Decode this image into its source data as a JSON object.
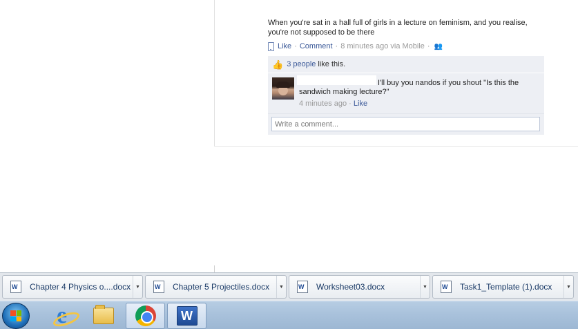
{
  "post": {
    "text": "When you're sat in a hall full of girls in a lecture on feminism, and you realise, you're not supposed to be there",
    "like_label": "Like",
    "comment_label": "Comment",
    "time": "8 minutes ago via Mobile",
    "sep": "·"
  },
  "likes": {
    "count_link": "3 people",
    "suffix": "like this."
  },
  "comment": {
    "text": "I'll buy you nandos if you shout \"Is this the sandwich making lecture?\"",
    "time": "4 minutes ago",
    "like_label": "Like"
  },
  "write_comment": {
    "placeholder": "Write a comment..."
  },
  "downloads": [
    {
      "name": "Chapter 4 Physics o....docx"
    },
    {
      "name": "Chapter 5 Projectiles.docx"
    },
    {
      "name": "Worksheet03.docx"
    },
    {
      "name": "Task1_Template (1).docx"
    }
  ],
  "taskbar": {
    "icons": [
      "windows-start-icon",
      "internet-explorer-icon",
      "file-explorer-icon",
      "chrome-icon",
      "word-icon"
    ],
    "word_letter": "W"
  },
  "colors": {
    "link": "#3b5998",
    "comment_bg": "#edeff4",
    "taskbar": "#a8c1db"
  }
}
